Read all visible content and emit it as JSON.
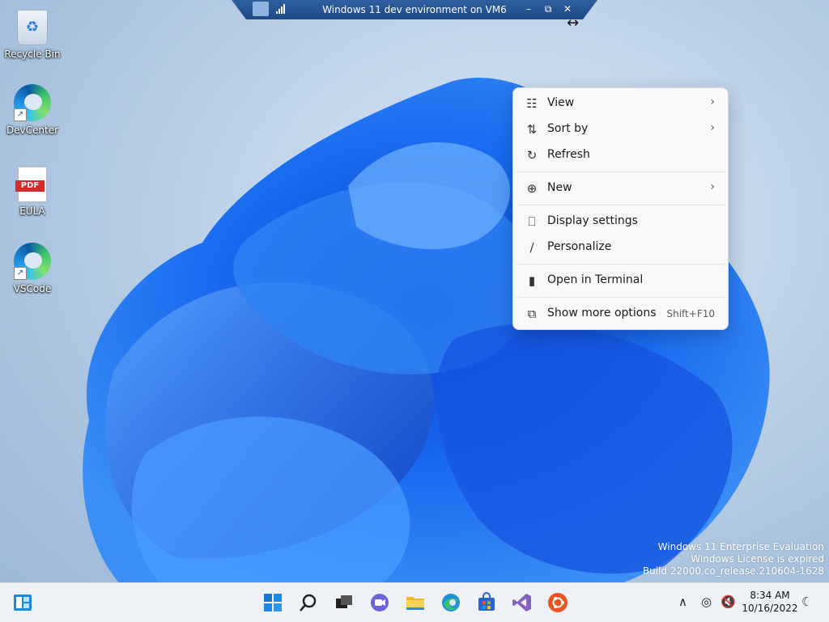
{
  "vm_bar": {
    "title": "Windows 11 dev environment on VM6",
    "minimize_glyph": "–",
    "restore_glyph": "⧉",
    "close_glyph": "✕"
  },
  "desktop_icons": [
    {
      "label": "Recycle Bin",
      "icon": "recycle-bin-icon"
    },
    {
      "label": "DevCenter",
      "icon": "edge-icon"
    },
    {
      "label": "EULA",
      "icon": "pdf-icon",
      "badge": "PDF"
    },
    {
      "label": "VSCode",
      "icon": "edge-icon"
    }
  ],
  "context_menu": {
    "items": [
      {
        "label": "View",
        "icon": "view-grid-icon",
        "glyph": "☷",
        "submenu": true
      },
      {
        "label": "Sort by",
        "icon": "sort-icon",
        "glyph": "⇅",
        "submenu": true
      },
      {
        "label": "Refresh",
        "icon": "refresh-icon",
        "glyph": "↻"
      },
      {
        "label": "New",
        "icon": "new-plus-icon",
        "glyph": "⊕",
        "submenu": true
      },
      {
        "label": "Display settings",
        "icon": "display-settings-icon",
        "glyph": "⎕"
      },
      {
        "label": "Personalize",
        "icon": "brush-icon",
        "glyph": "∕"
      },
      {
        "label": "Open in Terminal",
        "icon": "terminal-icon",
        "glyph": "▮"
      },
      {
        "label": "Show more options",
        "icon": "more-options-icon",
        "glyph": "⧉",
        "shortcut": "Shift+F10"
      }
    ],
    "submenu_arrow": "›"
  },
  "watermark": {
    "line1": "Windows 11 Enterprise Evaluation",
    "line2": "Windows License is expired",
    "line3": "Build 22000.co_release.210604-1628"
  },
  "taskbar": {
    "time": "8:34 AM",
    "date": "10/16/2022",
    "apps": [
      "widgets-icon",
      "start-icon",
      "search-icon",
      "task-view-icon",
      "chat-icon",
      "file-explorer-icon",
      "edge-icon",
      "store-icon",
      "visual-studio-icon",
      "ubuntu-icon"
    ],
    "tray_chevron": "∧",
    "tray_network": "◎",
    "tray_volume": "🔇",
    "tray_moon": "☾"
  },
  "colors": {
    "accent": "#0067c0",
    "vm_bar": "#1e4a86",
    "menu_bg": "#f9f9f9",
    "taskbar_bg": "#eef2f7"
  }
}
